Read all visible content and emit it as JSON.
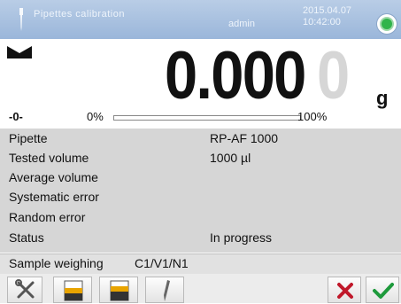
{
  "header": {
    "title": "Pipettes calibration",
    "user": "admin",
    "date": "2015.04.07",
    "time": "10:42:00",
    "status_icon": "status-ok-icon",
    "colors": {
      "bar": "#9ab6da",
      "status_ok": "#31b44b"
    }
  },
  "display": {
    "stability_icon": "stable-icon",
    "value": "0.000",
    "last_digit": "0",
    "unit": "g",
    "zero_indicator": "-0-",
    "progress_min_label": "0%",
    "progress_max_label": "100%",
    "progress_fraction": 0
  },
  "info": {
    "rows": [
      {
        "label": "Pipette",
        "value": "RP-AF 1000"
      },
      {
        "label": "Tested volume",
        "value": "1000 µl"
      },
      {
        "label": "Average volume",
        "value": ""
      },
      {
        "label": "Systematic error",
        "value": ""
      },
      {
        "label": "Random error",
        "value": ""
      },
      {
        "label": "Status",
        "value": "In progress"
      }
    ]
  },
  "status_strip": {
    "label": "Sample weighing",
    "value": "C1/V1/N1"
  },
  "toolbar": {
    "buttons": [
      {
        "icon": "settings-tools-icon"
      },
      {
        "icon": "tare-icon"
      },
      {
        "icon": "print-header-icon"
      },
      {
        "icon": "pipette-icon"
      },
      {
        "icon": "cancel-icon",
        "color": "#c0182a"
      },
      {
        "icon": "confirm-icon",
        "color": "#1e9a3c"
      }
    ]
  }
}
